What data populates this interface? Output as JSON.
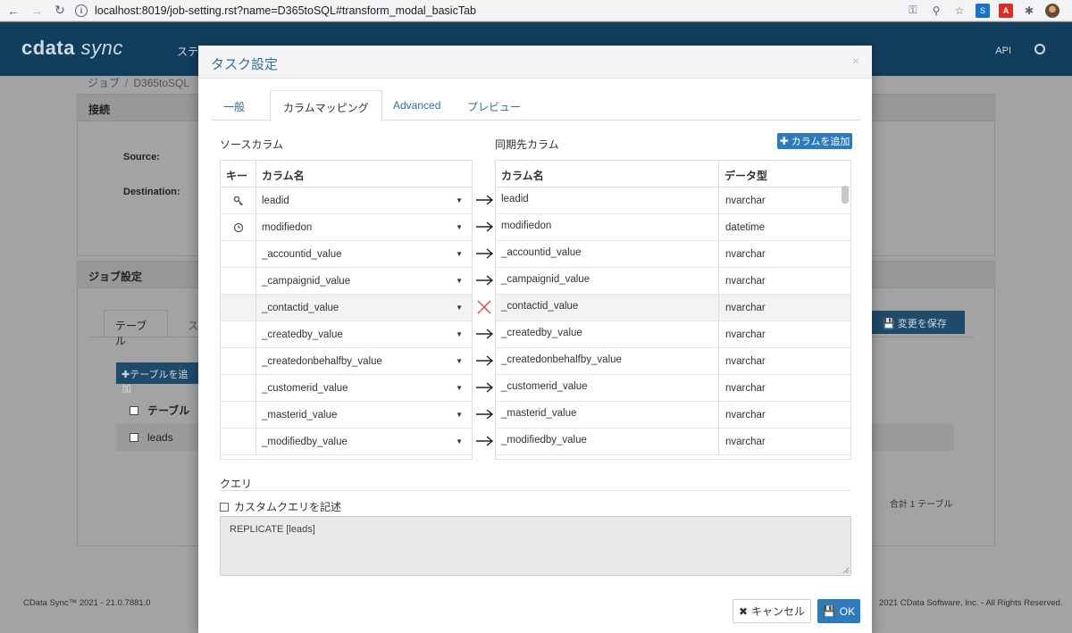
{
  "browser": {
    "url": "localhost:8019/job-setting.rst?name=D365toSQL#transform_modal_basicTab"
  },
  "app": {
    "logo_main": "cdata",
    "logo_sub": "sync",
    "nav_item": "ステ",
    "api_label": "API",
    "breadcrumb_root": "ジョブ",
    "breadcrumb_current": "D365toSQL",
    "connection_panel_title": "接続",
    "source_label": "Source:",
    "destination_label": "Destination:",
    "job_settings_title": "ジョブ設定",
    "bg_tab_table": "テーブル",
    "bg_tab_other": "ス",
    "bg_add_table": "テーブルを追加",
    "bg_save_changes": "変更を保存",
    "bg_table_header": "テーブル",
    "bg_table_row": "leads",
    "bg_total": "合計 1 テーブル",
    "footer_left": "CData Sync™ 2021 - 21.0.7881.0",
    "footer_right": "2021 CData Software, Inc. - All Rights Reserved."
  },
  "modal": {
    "title": "タスク設定",
    "close": "×",
    "tabs": [
      {
        "label": "一般",
        "active": false
      },
      {
        "label": "カラムマッピング",
        "active": true
      },
      {
        "label": "Advanced",
        "active": false
      },
      {
        "label": "プレビュー",
        "active": false
      }
    ],
    "source_columns_label": "ソースカラム",
    "dest_columns_label": "同期先カラム",
    "add_column_button": "カラムを追加",
    "source_headers": {
      "key": "キー",
      "column": "カラム名"
    },
    "dest_headers": {
      "column": "カラム名",
      "type": "データ型"
    },
    "rows": [
      {
        "key": "key-icon",
        "source": "leadid",
        "mapping": "arrow",
        "dest": "leadid",
        "type": "nvarchar"
      },
      {
        "key": "clock-icon",
        "source": "modifiedon",
        "mapping": "arrow",
        "dest": "modifiedon",
        "type": "datetime"
      },
      {
        "key": "",
        "source": "_accountid_value",
        "mapping": "arrow",
        "dest": "_accountid_value",
        "type": "nvarchar"
      },
      {
        "key": "",
        "source": "_campaignid_value",
        "mapping": "arrow",
        "dest": "_campaignid_value",
        "type": "nvarchar"
      },
      {
        "key": "",
        "source": "_contactid_value",
        "mapping": "excluded",
        "dest": "_contactid_value",
        "type": "nvarchar"
      },
      {
        "key": "",
        "source": "_createdby_value",
        "mapping": "arrow",
        "dest": "_createdby_value",
        "type": "nvarchar"
      },
      {
        "key": "",
        "source": "_createdonbehalfby_value",
        "mapping": "arrow",
        "dest": "_createdonbehalfby_value",
        "type": "nvarchar"
      },
      {
        "key": "",
        "source": "_customerid_value",
        "mapping": "arrow",
        "dest": "_customerid_value",
        "type": "nvarchar"
      },
      {
        "key": "",
        "source": "_masterid_value",
        "mapping": "arrow",
        "dest": "_masterid_value",
        "type": "nvarchar"
      },
      {
        "key": "",
        "source": "_modifiedby_value",
        "mapping": "arrow",
        "dest": "_modifiedby_value",
        "type": "nvarchar"
      }
    ],
    "query_label": "クエリ",
    "custom_query_label": "カスタムクエリを記述",
    "query_text": "REPLICATE [leads]",
    "cancel_button": "キャンセル",
    "ok_button": "OK"
  },
  "colors": {
    "accent": "#2b7bbd",
    "header": "#123e5e",
    "excluded": "#e0453a"
  }
}
